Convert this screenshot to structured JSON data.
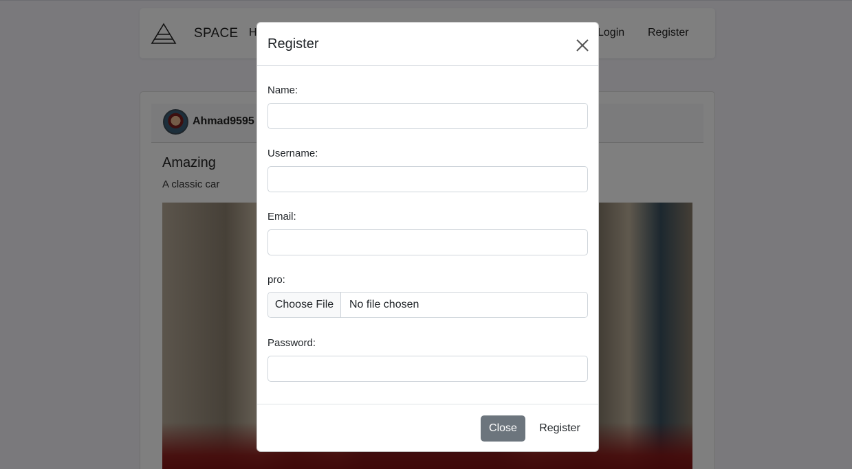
{
  "navbar": {
    "brand": "SPACE",
    "home_label": "H",
    "login_label": "Login",
    "register_label": "Register",
    "logo_icon": "triangle-logo-icon"
  },
  "post": {
    "author": "Ahmad9595",
    "title": "Amazing",
    "description": "A classic car"
  },
  "modal": {
    "title": "Register",
    "fields": {
      "name_label": "Name:",
      "name_value": "",
      "username_label": "Username:",
      "username_value": "",
      "email_label": "Email:",
      "email_value": "",
      "pro_label": "pro:",
      "file_button": "Choose File",
      "file_status": "No file chosen",
      "password_label": "Password:",
      "password_value": ""
    },
    "footer": {
      "close_label": "Close",
      "register_label": "Register"
    }
  },
  "colors": {
    "close_button_bg": "#6c757d",
    "backdrop": "rgba(0,0,0,0.5)"
  }
}
